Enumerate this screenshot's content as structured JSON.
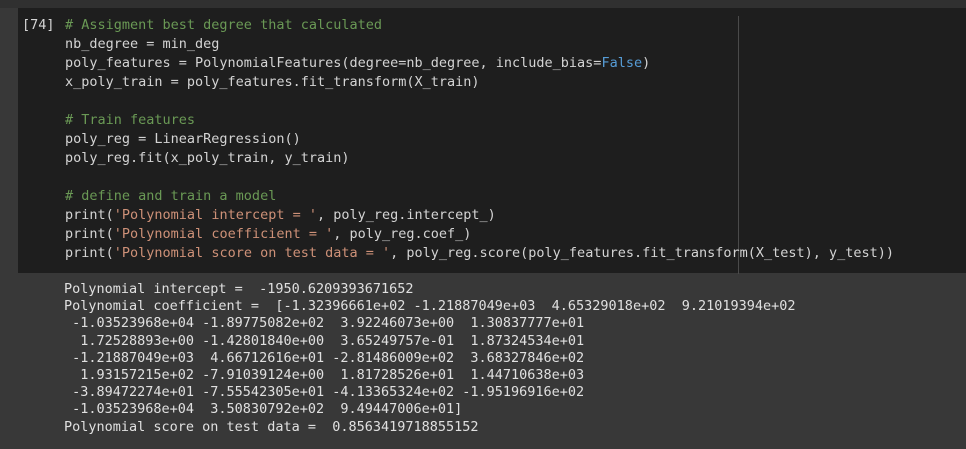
{
  "cell": {
    "exec_count": "[74]",
    "code": {
      "l1_comment": "# Assigment best degree that calculated",
      "l2": "nb_degree = min_deg",
      "l3_a": "poly_features = PolynomialFeatures(degree=nb_degree, include_bias=",
      "l3_kw": "False",
      "l3_b": ")",
      "l4": "x_poly_train = poly_features.fit_transform(X_train)",
      "l6_comment": "# Train features",
      "l7": "poly_reg = LinearRegression()",
      "l8": "poly_reg.fit(x_poly_train, y_train)",
      "l10_comment": "# define and train a model",
      "l11_fn": "print(",
      "l11_str": "'Polynomial intercept = '",
      "l11_rest": ", poly_reg.intercept_)",
      "l12_fn": "print(",
      "l12_str": "'Polynomial coefficient = '",
      "l12_rest": ", poly_reg.coef_)",
      "l13_fn": "print(",
      "l13_str": "'Polynomial score on test data = '",
      "l13_rest": ", poly_reg.score(poly_features.fit_transform(X_test), y_test))"
    }
  },
  "output": {
    "lines": [
      "Polynomial intercept =  -1950.6209393671652",
      "Polynomial coefficient =  [-1.32396661e+02 -1.21887049e+03  4.65329018e+02  9.21019394e+02",
      " -1.03523968e+04 -1.89775082e+02  3.92246073e+00  1.30837777e+01",
      "  1.72528893e+00 -1.42801840e+00  3.65249757e-01  1.87324534e+01",
      " -1.21887049e+03  4.66712616e+01 -2.81486009e+02  3.68327846e+02",
      "  1.93157215e+02 -7.91039124e+00  1.81728526e+01  1.44710638e+03",
      " -3.89472274e+01 -7.55542305e+01 -4.13365324e+02 -1.95196916e+02",
      " -1.03523968e+04  3.50830792e+02  9.49447006e+01]",
      "Polynomial score on test data =  0.8563419718855152"
    ]
  }
}
